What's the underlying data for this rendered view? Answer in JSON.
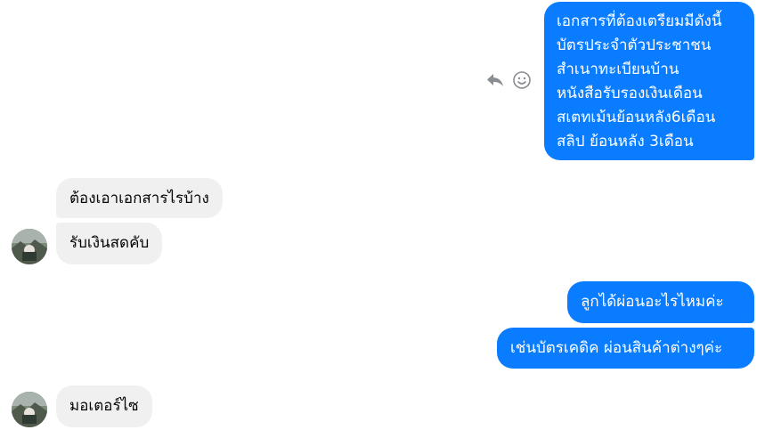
{
  "conversation": {
    "messages": [
      {
        "direction": "outgoing",
        "lines": [
          "เอกสารที่ต้องเตรียมมีดังนี้",
          "บัตรประจำตัวประชาชน",
          "สำเนาทะเบียนบ้าน",
          "หนังสือรับรองเงินเดือน",
          "สเตทเม้นย้อนหลัง6เดือน",
          "สลิป ย้อนหลัง 3เดือน"
        ]
      },
      {
        "direction": "incoming",
        "text": "ต้องเอาเอกสารไรบ้าง"
      },
      {
        "direction": "incoming",
        "text": "รับเงินสดคับ"
      },
      {
        "direction": "outgoing",
        "text": "ลูกได้ผ่อนอะไรไหมค่ะ"
      },
      {
        "direction": "outgoing",
        "text": "เช่นบัตรเคดิค ผ่อนสินค้าต่างๆค่ะ"
      },
      {
        "direction": "incoming",
        "text": "มอเตอร์ไซ"
      }
    ]
  },
  "message_actions": {
    "icons": [
      "reply-icon",
      "react-smiley-icon"
    ]
  },
  "colors": {
    "outgoing_bubble": "#0a7cff",
    "incoming_bubble": "#f0f0f0",
    "action_icon": "#8a8d91"
  }
}
